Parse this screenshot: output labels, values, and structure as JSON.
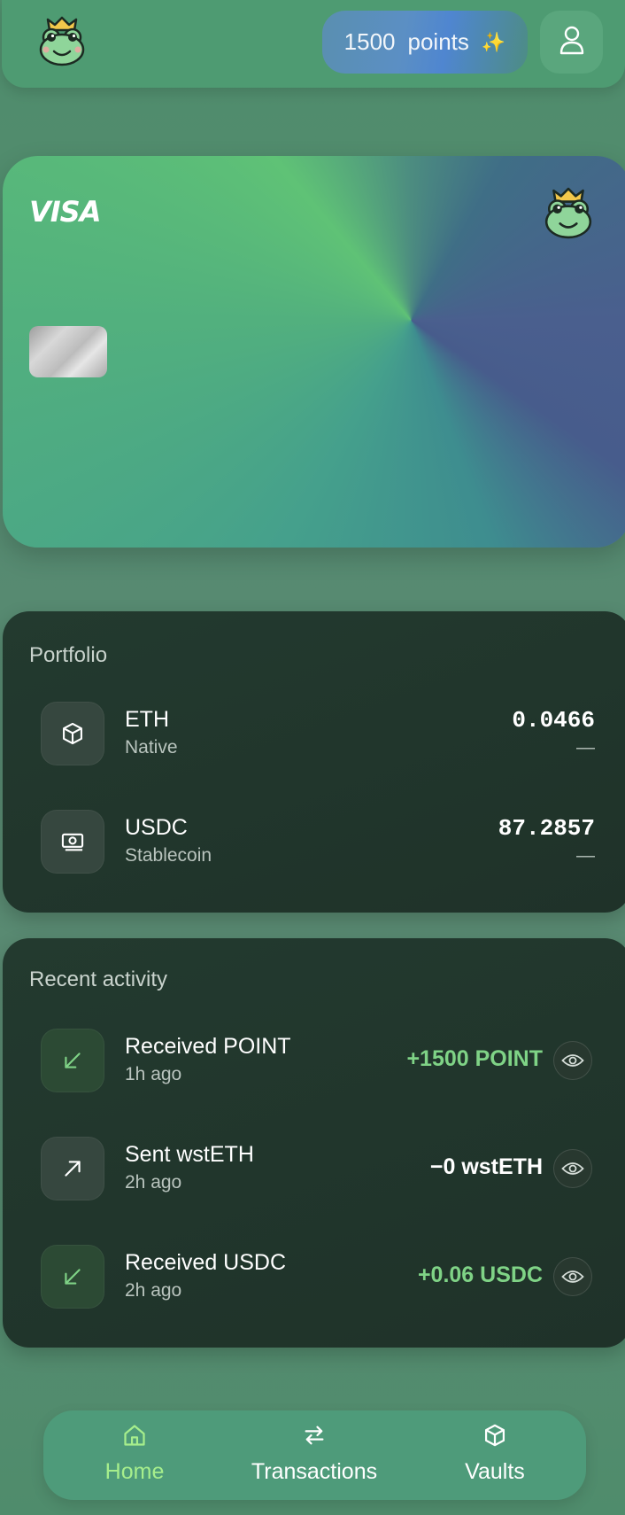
{
  "header": {
    "points_value": "1500",
    "points_label": "points",
    "points_icon": "sparkles-icon",
    "profile_icon": "user-icon"
  },
  "card": {
    "brand": "VISA",
    "chip": "card-chip",
    "logo": "frog-king-logo"
  },
  "portfolio": {
    "title": "Portfolio",
    "items": [
      {
        "symbol": "ETH",
        "type": "Native",
        "amount": "0.0466",
        "fiat": "—",
        "icon": "cube-icon"
      },
      {
        "symbol": "USDC",
        "type": "Stablecoin",
        "amount": "87.2857",
        "fiat": "—",
        "icon": "cash-icon"
      }
    ]
  },
  "activity": {
    "title": "Recent activity",
    "items": [
      {
        "title": "Received POINT",
        "time": "1h ago",
        "amount": "+1500 POINT",
        "direction": "in",
        "icon": "arrow-down-left-icon"
      },
      {
        "title": "Sent wstETH",
        "time": "2h ago",
        "amount": "−0 wstETH",
        "direction": "out",
        "icon": "arrow-up-right-icon"
      },
      {
        "title": "Received USDC",
        "time": "2h ago",
        "amount": "+0.06 USDC",
        "direction": "in",
        "icon": "arrow-down-left-icon"
      }
    ]
  },
  "nav": {
    "items": [
      {
        "label": "Home",
        "icon": "home-icon",
        "active": true
      },
      {
        "label": "Transactions",
        "icon": "swap-arrows-icon",
        "active": false
      },
      {
        "label": "Vaults",
        "icon": "cube-icon",
        "active": false
      }
    ]
  },
  "colors": {
    "accent_green": "#7fd386",
    "nav_active": "#a6ee8c",
    "panel_bg": "#223a2e",
    "header_bg": "#4e9b72"
  }
}
